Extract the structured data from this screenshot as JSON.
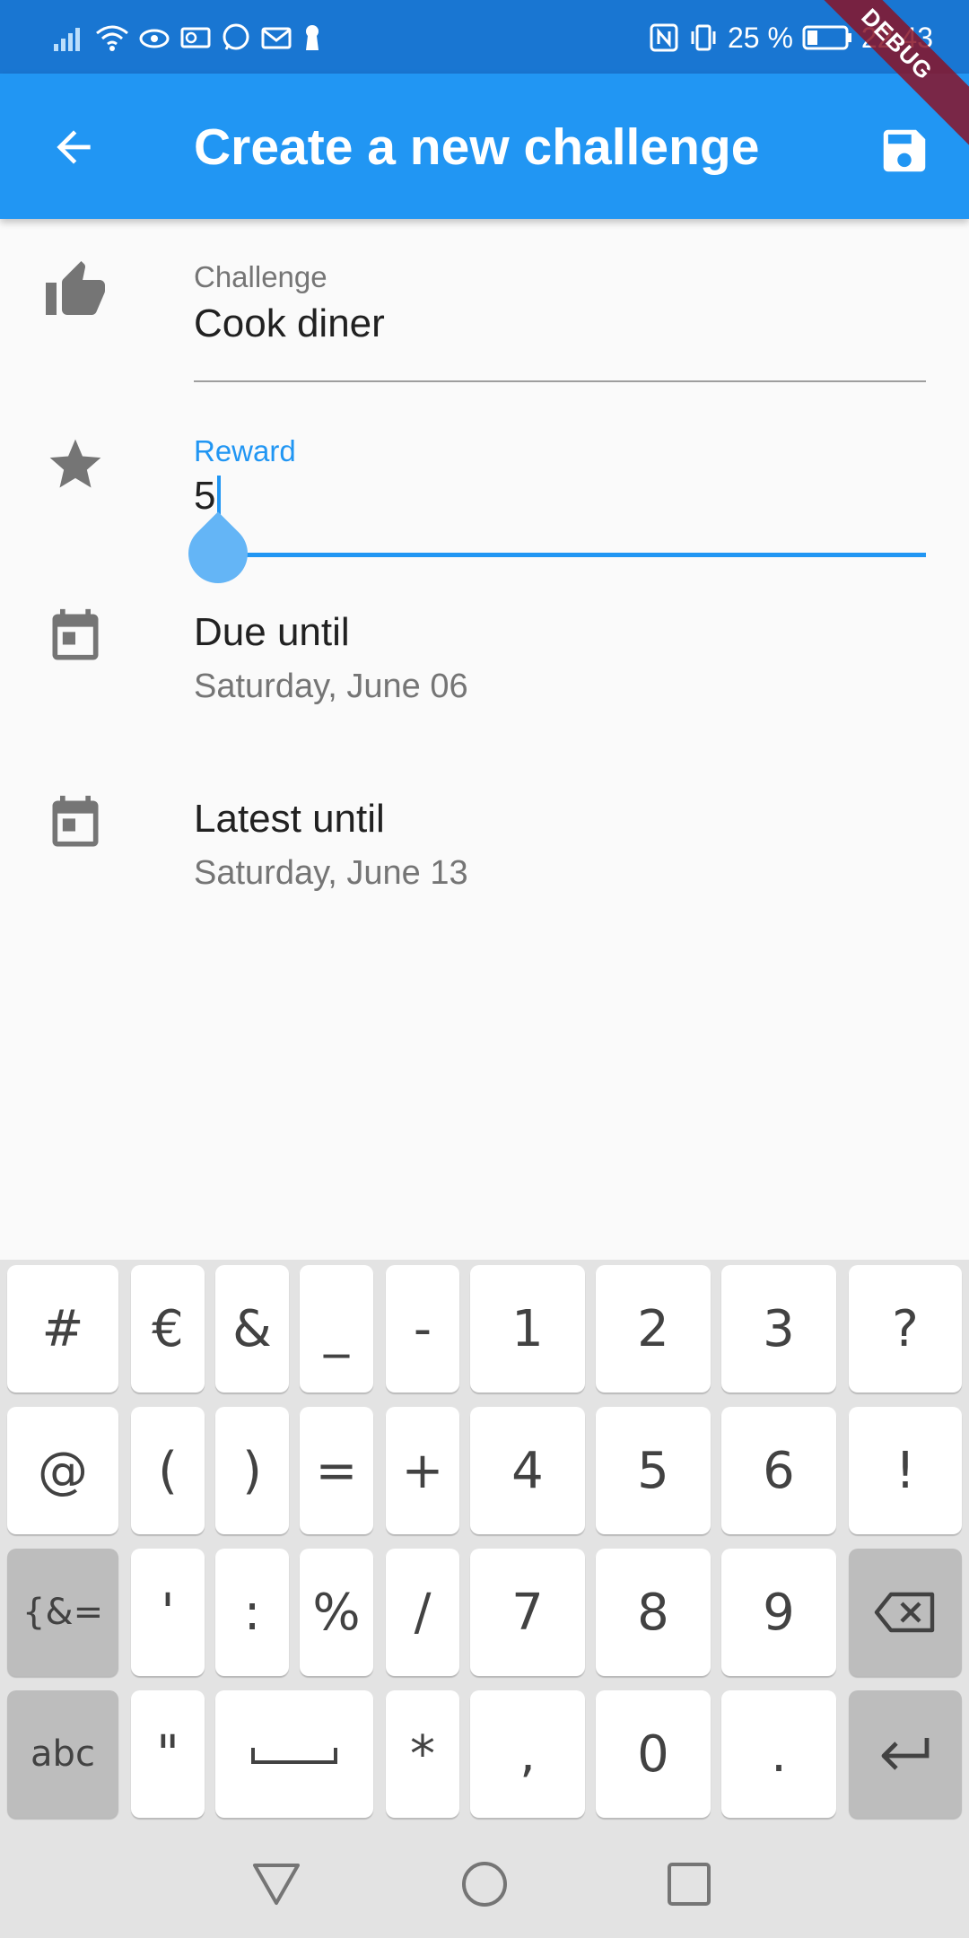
{
  "status_bar": {
    "battery": "25 %",
    "time": "22:43"
  },
  "debug_banner": "DEBUG",
  "app_bar": {
    "title": "Create a new challenge",
    "back_icon": "arrow-back-icon",
    "save_icon": "save-icon"
  },
  "form": {
    "challenge": {
      "label": "Challenge",
      "value": "Cook diner",
      "icon": "thumb-up-icon"
    },
    "reward": {
      "label": "Reward",
      "value": "5",
      "icon": "star-icon"
    },
    "due_until": {
      "title": "Due until",
      "date": "Saturday, June 06",
      "icon": "calendar-icon"
    },
    "latest_until": {
      "title": "Latest until",
      "date": "Saturday, June 13",
      "icon": "calendar-icon"
    }
  },
  "keyboard": {
    "rows": [
      [
        "#",
        "€",
        "&",
        "_",
        "-",
        "1",
        "2",
        "3",
        "?"
      ],
      [
        "@",
        "(",
        ")",
        "=",
        "+",
        "4",
        "5",
        "6",
        "!"
      ],
      [
        "{&=",
        "'",
        ":",
        "%",
        "/",
        "7",
        "8",
        "9",
        "backspace"
      ],
      [
        "abc",
        "\"",
        "space",
        "*",
        ",",
        "0",
        ".",
        "enter"
      ]
    ]
  },
  "colors": {
    "primary": "#2196f3",
    "status_bar": "#1976d2",
    "accent_handle": "#64b5f6"
  }
}
